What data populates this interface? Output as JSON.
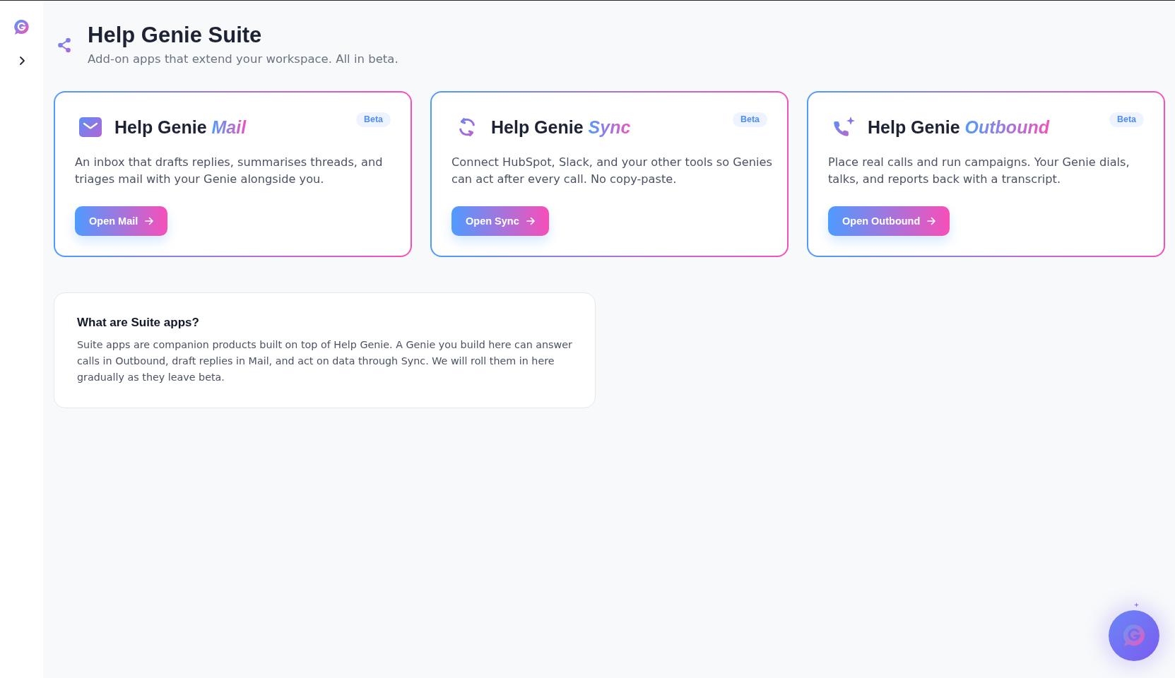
{
  "header": {
    "title": "Help Genie Suite",
    "subtitle": "Add-on apps that extend your workspace. All in beta."
  },
  "apps": [
    {
      "kind": "mail",
      "title": "Help Genie *Mail*",
      "badge": "Beta",
      "description": "An inbox that drafts replies, summarises threads, and triages mail with your Genie alongside you.",
      "button": "Open Mail"
    },
    {
      "kind": "sync",
      "title": "Help Genie *Sync*",
      "badge": "Beta",
      "description": "Connect HubSpot, Slack, and your other tools so Genies can act after every call. No copy-paste.",
      "button": "Open Sync"
    },
    {
      "kind": "outbound",
      "title": "Help Genie *Outbound*",
      "badge": "Beta",
      "description": "Place real calls and run campaigns. Your Genie dials, talks, and reports back with a transcript.",
      "button": "Open Outbound"
    }
  ],
  "info": {
    "title": "What are Suite apps?",
    "text": "Suite apps are companion products built on top of Help Genie. A Genie you build here can answer calls in Outbound, draft replies in Mail, and act on data through Sync. We will roll them in here gradually as they leave beta."
  }
}
